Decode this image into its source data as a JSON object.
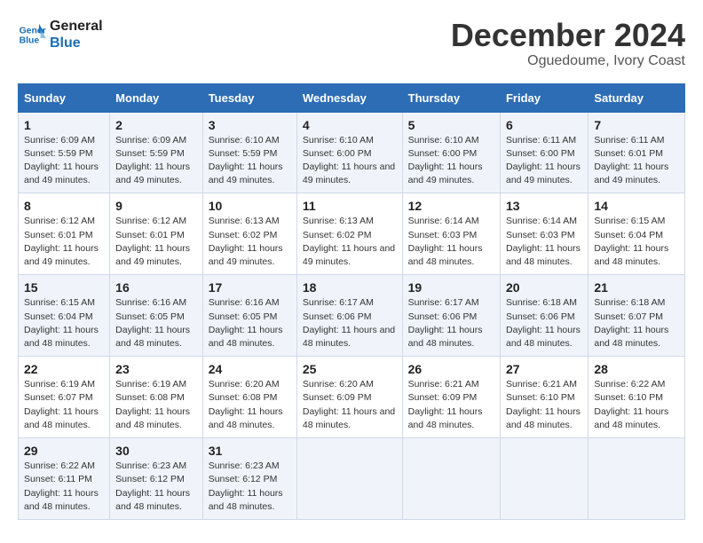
{
  "header": {
    "logo_line1": "General",
    "logo_line2": "Blue",
    "month": "December 2024",
    "location": "Oguedoume, Ivory Coast"
  },
  "weekdays": [
    "Sunday",
    "Monday",
    "Tuesday",
    "Wednesday",
    "Thursday",
    "Friday",
    "Saturday"
  ],
  "weeks": [
    [
      {
        "day": "1",
        "sunrise": "6:09 AM",
        "sunset": "5:59 PM",
        "daylight": "11 hours and 49 minutes."
      },
      {
        "day": "2",
        "sunrise": "6:09 AM",
        "sunset": "5:59 PM",
        "daylight": "11 hours and 49 minutes."
      },
      {
        "day": "3",
        "sunrise": "6:10 AM",
        "sunset": "5:59 PM",
        "daylight": "11 hours and 49 minutes."
      },
      {
        "day": "4",
        "sunrise": "6:10 AM",
        "sunset": "6:00 PM",
        "daylight": "11 hours and 49 minutes."
      },
      {
        "day": "5",
        "sunrise": "6:10 AM",
        "sunset": "6:00 PM",
        "daylight": "11 hours and 49 minutes."
      },
      {
        "day": "6",
        "sunrise": "6:11 AM",
        "sunset": "6:00 PM",
        "daylight": "11 hours and 49 minutes."
      },
      {
        "day": "7",
        "sunrise": "6:11 AM",
        "sunset": "6:01 PM",
        "daylight": "11 hours and 49 minutes."
      }
    ],
    [
      {
        "day": "8",
        "sunrise": "6:12 AM",
        "sunset": "6:01 PM",
        "daylight": "11 hours and 49 minutes."
      },
      {
        "day": "9",
        "sunrise": "6:12 AM",
        "sunset": "6:01 PM",
        "daylight": "11 hours and 49 minutes."
      },
      {
        "day": "10",
        "sunrise": "6:13 AM",
        "sunset": "6:02 PM",
        "daylight": "11 hours and 49 minutes."
      },
      {
        "day": "11",
        "sunrise": "6:13 AM",
        "sunset": "6:02 PM",
        "daylight": "11 hours and 49 minutes."
      },
      {
        "day": "12",
        "sunrise": "6:14 AM",
        "sunset": "6:03 PM",
        "daylight": "11 hours and 48 minutes."
      },
      {
        "day": "13",
        "sunrise": "6:14 AM",
        "sunset": "6:03 PM",
        "daylight": "11 hours and 48 minutes."
      },
      {
        "day": "14",
        "sunrise": "6:15 AM",
        "sunset": "6:04 PM",
        "daylight": "11 hours and 48 minutes."
      }
    ],
    [
      {
        "day": "15",
        "sunrise": "6:15 AM",
        "sunset": "6:04 PM",
        "daylight": "11 hours and 48 minutes."
      },
      {
        "day": "16",
        "sunrise": "6:16 AM",
        "sunset": "6:05 PM",
        "daylight": "11 hours and 48 minutes."
      },
      {
        "day": "17",
        "sunrise": "6:16 AM",
        "sunset": "6:05 PM",
        "daylight": "11 hours and 48 minutes."
      },
      {
        "day": "18",
        "sunrise": "6:17 AM",
        "sunset": "6:06 PM",
        "daylight": "11 hours and 48 minutes."
      },
      {
        "day": "19",
        "sunrise": "6:17 AM",
        "sunset": "6:06 PM",
        "daylight": "11 hours and 48 minutes."
      },
      {
        "day": "20",
        "sunrise": "6:18 AM",
        "sunset": "6:06 PM",
        "daylight": "11 hours and 48 minutes."
      },
      {
        "day": "21",
        "sunrise": "6:18 AM",
        "sunset": "6:07 PM",
        "daylight": "11 hours and 48 minutes."
      }
    ],
    [
      {
        "day": "22",
        "sunrise": "6:19 AM",
        "sunset": "6:07 PM",
        "daylight": "11 hours and 48 minutes."
      },
      {
        "day": "23",
        "sunrise": "6:19 AM",
        "sunset": "6:08 PM",
        "daylight": "11 hours and 48 minutes."
      },
      {
        "day": "24",
        "sunrise": "6:20 AM",
        "sunset": "6:08 PM",
        "daylight": "11 hours and 48 minutes."
      },
      {
        "day": "25",
        "sunrise": "6:20 AM",
        "sunset": "6:09 PM",
        "daylight": "11 hours and 48 minutes."
      },
      {
        "day": "26",
        "sunrise": "6:21 AM",
        "sunset": "6:09 PM",
        "daylight": "11 hours and 48 minutes."
      },
      {
        "day": "27",
        "sunrise": "6:21 AM",
        "sunset": "6:10 PM",
        "daylight": "11 hours and 48 minutes."
      },
      {
        "day": "28",
        "sunrise": "6:22 AM",
        "sunset": "6:10 PM",
        "daylight": "11 hours and 48 minutes."
      }
    ],
    [
      {
        "day": "29",
        "sunrise": "6:22 AM",
        "sunset": "6:11 PM",
        "daylight": "11 hours and 48 minutes."
      },
      {
        "day": "30",
        "sunrise": "6:23 AM",
        "sunset": "6:12 PM",
        "daylight": "11 hours and 48 minutes."
      },
      {
        "day": "31",
        "sunrise": "6:23 AM",
        "sunset": "6:12 PM",
        "daylight": "11 hours and 48 minutes."
      },
      null,
      null,
      null,
      null
    ]
  ]
}
